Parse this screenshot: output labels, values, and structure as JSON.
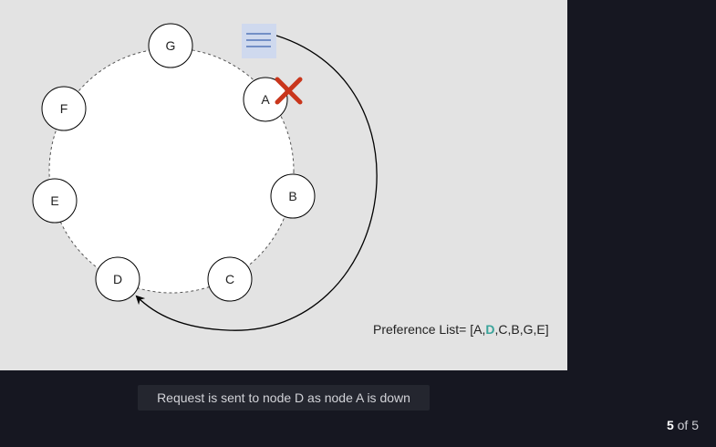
{
  "diagram": {
    "nodes": [
      "G",
      "A",
      "B",
      "C",
      "D",
      "E",
      "F"
    ],
    "down_node": "A",
    "target_node": "D",
    "preference_list": {
      "prefix": "Preference List= [A,",
      "highlight": "D",
      "suffix": ",C,B,G,E]"
    },
    "colors": {
      "canvas": "#e3e3e3",
      "ring_fill": "#ffffff",
      "highlight": "#3aa39a",
      "cross": "#c9361c",
      "request_box": "#cfd9ee",
      "request_lines": "#5577b8"
    }
  },
  "caption": "Request is sent to node D as node A is down",
  "pagination": {
    "current": "5",
    "separator": "of",
    "total": "5"
  }
}
